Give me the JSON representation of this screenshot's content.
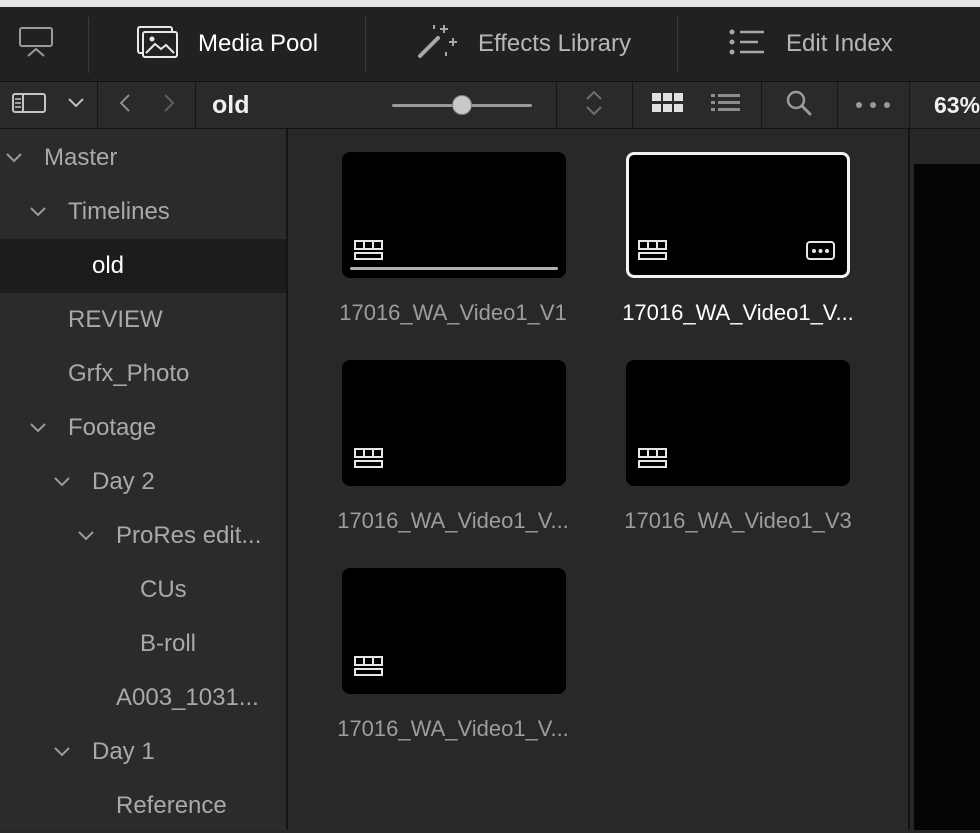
{
  "header": {
    "media_pool": "Media Pool",
    "effects_library": "Effects Library",
    "edit_index": "Edit Index"
  },
  "toolbar": {
    "bin_name": "old",
    "zoom": "63%"
  },
  "tree": [
    {
      "label": "Master"
    },
    {
      "label": "Timelines"
    },
    {
      "label": "old"
    },
    {
      "label": "REVIEW"
    },
    {
      "label": "Grfx_Photo"
    },
    {
      "label": "Footage"
    },
    {
      "label": "Day 2"
    },
    {
      "label": "ProRes edit..."
    },
    {
      "label": "CUs"
    },
    {
      "label": "B-roll"
    },
    {
      "label": "A003_1031..."
    },
    {
      "label": "Day 1"
    },
    {
      "label": "Reference"
    }
  ],
  "clips": [
    {
      "name": "17016_WA_Video1_V1"
    },
    {
      "name": "17016_WA_Video1_V..."
    },
    {
      "name": "17016_WA_Video1_V..."
    },
    {
      "name": "17016_WA_Video1_V3"
    },
    {
      "name": "17016_WA_Video1_V..."
    }
  ],
  "colors": {
    "background": "#282828",
    "header": "#212121",
    "selected_row": "#1c1c1c",
    "thumbnail": "#000000",
    "selection_border": "#f2f2f2"
  }
}
